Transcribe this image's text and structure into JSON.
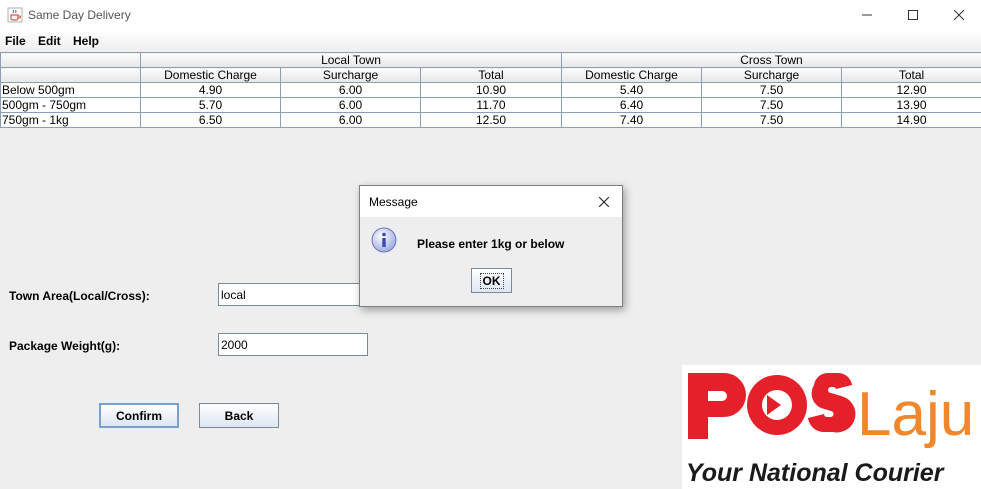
{
  "window": {
    "title": "Same Day Delivery",
    "icon": "java-cup-icon"
  },
  "menu": {
    "file": "File",
    "edit": "Edit",
    "help": "Help"
  },
  "table": {
    "groups": [
      "",
      "Local Town",
      "Cross Town"
    ],
    "columns": [
      "",
      "Domestic Charge",
      "Surcharge",
      "Total",
      "Domestic Charge",
      "Surcharge",
      "Total"
    ],
    "rows": [
      [
        "Below 500gm",
        "4.90",
        "6.00",
        "10.90",
        "5.40",
        "7.50",
        "12.90"
      ],
      [
        "500gm - 750gm",
        "5.70",
        "6.00",
        "11.70",
        "6.40",
        "7.50",
        "13.90"
      ],
      [
        "750gm - 1kg",
        "6.50",
        "6.00",
        "12.50",
        "7.40",
        "7.50",
        "14.90"
      ]
    ]
  },
  "form": {
    "town_label": "Town Area(Local/Cross):",
    "town_value": "local",
    "weight_label": "Package Weight(g):",
    "weight_value": "2000",
    "confirm_label": "Confirm",
    "back_label": "Back"
  },
  "logo": {
    "brand": "POS Laju",
    "pos": "POS",
    "laju": "Laju",
    "tagline": "Your National Courier",
    "red": "#e4202a",
    "orange": "#f0872a"
  },
  "dialog": {
    "title": "Message",
    "message": "Please enter 1kg or below",
    "ok_label": "OK",
    "icon": "info-icon"
  }
}
